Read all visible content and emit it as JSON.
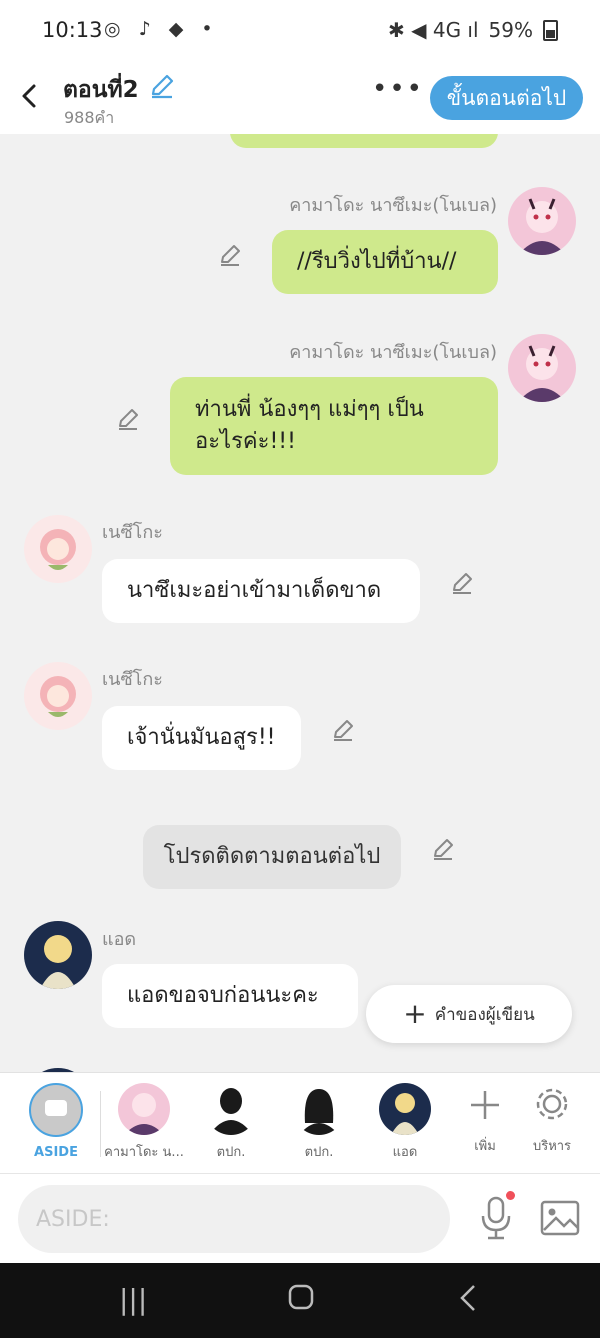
{
  "status": {
    "time": "10:13",
    "left_icons": "◎ ♪ ◆ •",
    "right_icons": "✱ ◀ 4G ıl",
    "battery": "59%"
  },
  "header": {
    "title": "ตอนที่2",
    "word_count": "988คำ",
    "next_button": "ขั้นตอนต่อไป"
  },
  "messages": [
    {
      "sender": "คามาโดะ นาซึเมะ(โนเบล)",
      "text": "//รีบวิ่งไปที่บ้าน//"
    },
    {
      "sender": "คามาโดะ นาซึเมะ(โนเบล)",
      "line1": "ท่านพี่ น้องๆๆ แม่ๆๆ เป็น",
      "line2": "อะไรค่ะ!!!"
    },
    {
      "sender": "เนซึโกะ",
      "text": "นาซึเมะอย่าเข้ามาเด็ดขาด"
    },
    {
      "sender": "เนซึโกะ",
      "text": "เจ้านั่นมันอสูร!!"
    },
    {
      "text": "โปรดติดตามตอนต่อไป"
    },
    {
      "sender": "แอด",
      "text": "แอดขอจบก่อนนะคะ"
    }
  ],
  "fab_label": "คำของผู้เขียน",
  "characters": [
    {
      "label": "ASIDE"
    },
    {
      "label": "คามาโดะ น..."
    },
    {
      "label": "ตปก."
    },
    {
      "label": "ตปก."
    },
    {
      "label": "แอด"
    },
    {
      "label": "เพิ่ม"
    },
    {
      "label": "บริหาร"
    }
  ],
  "input": {
    "placeholder": "ASIDE:"
  },
  "colors": {
    "accent": "#4aa3e0",
    "own_bubble": "#cfe98c",
    "other_bubble": "#ffffff"
  }
}
